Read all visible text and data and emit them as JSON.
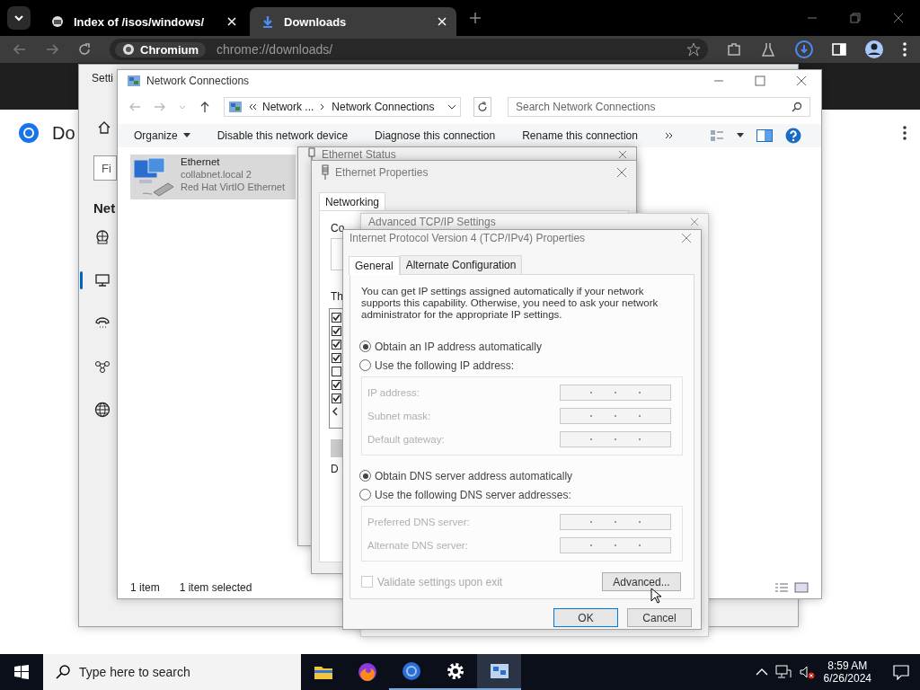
{
  "browser": {
    "tabs": [
      {
        "title": "Index of /isos/windows/",
        "selected": false,
        "kind": "folder"
      },
      {
        "title": "Downloads",
        "selected": true,
        "kind": "download"
      }
    ],
    "omnibox": {
      "chip": "Chromium",
      "url": "chrome://downloads/"
    },
    "page": {
      "heading": "Do"
    }
  },
  "settings_window": {
    "title": "Setti",
    "search_placeholder": "Fi",
    "heading": "Net",
    "nav": [
      {
        "kind": "globe-monitor",
        "selected": false
      },
      {
        "kind": "monitor",
        "selected": true
      },
      {
        "kind": "phone",
        "selected": false
      },
      {
        "kind": "nodes",
        "selected": false
      },
      {
        "kind": "globe",
        "selected": false
      }
    ]
  },
  "network_connections": {
    "title": "Network Connections",
    "breadcrumb": [
      "Network ...",
      "Network Connections"
    ],
    "search_placeholder": "Search Network Connections",
    "commands": [
      "Organize",
      "Disable this network device",
      "Diagnose this connection",
      "Rename this connection"
    ],
    "items": [
      {
        "name": "Ethernet",
        "network": "collabnet.local 2",
        "adapter": "Red Hat VirtIO Ethernet",
        "selected": true
      }
    ],
    "status": [
      "1 item",
      "1 item selected"
    ]
  },
  "ethernet_status": {
    "title": "Ethernet Status"
  },
  "ethernet_properties": {
    "title": "Ethernet Properties",
    "tabs": [
      {
        "label": "Networking",
        "selected": true
      }
    ],
    "connect_label": "Co",
    "items_label": "Th",
    "description_label": "D",
    "components": [
      {
        "checked": true
      },
      {
        "checked": true
      },
      {
        "checked": true
      },
      {
        "checked": true
      },
      {
        "checked": false
      },
      {
        "checked": true
      },
      {
        "checked": true
      }
    ]
  },
  "advanced_tcpip": {
    "title": "Advanced TCP/IP Settings"
  },
  "ipv4_properties": {
    "title": "Internet Protocol Version 4 (TCP/IPv4) Properties",
    "tabs": [
      {
        "label": "General",
        "selected": true
      },
      {
        "label": "Alternate Configuration",
        "selected": false
      }
    ],
    "intro": "You can get IP settings assigned automatically if your network supports this capability. Otherwise, you need to ask your network administrator for the appropriate IP settings.",
    "ip_options": [
      {
        "label": "Obtain an IP address automatically",
        "selected": true
      },
      {
        "label": "Use the following IP address:",
        "selected": false
      }
    ],
    "ip_fields": [
      {
        "label": "IP address:",
        "disabled": true
      },
      {
        "label": "Subnet mask:",
        "disabled": true
      },
      {
        "label": "Default gateway:",
        "disabled": true
      }
    ],
    "dns_options": [
      {
        "label": "Obtain DNS server address automatically",
        "selected": true
      },
      {
        "label": "Use the following DNS server addresses:",
        "selected": false
      }
    ],
    "dns_fields": [
      {
        "label": "Preferred DNS server:",
        "disabled": true
      },
      {
        "label": "Alternate DNS server:",
        "disabled": true
      }
    ],
    "validate": {
      "label": "Validate settings upon exit",
      "checked": false,
      "disabled": true
    },
    "advanced_button": "Advanced...",
    "buttons": [
      "OK",
      "Cancel"
    ]
  },
  "taskbar": {
    "search_placeholder": "Type here to search",
    "apps": [
      {
        "kind": "folder",
        "running": false,
        "selected": false
      },
      {
        "kind": "fox",
        "running": false,
        "selected": false
      },
      {
        "kind": "round",
        "running": true,
        "selected": false
      },
      {
        "kind": "gear",
        "running": true,
        "selected": false
      },
      {
        "kind": "netwin",
        "running": true,
        "selected": true
      }
    ],
    "time": "8:59 AM",
    "date": "6/26/2024"
  }
}
